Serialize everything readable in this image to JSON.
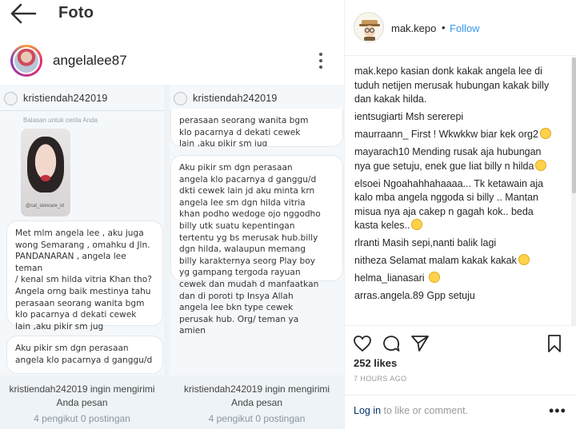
{
  "header": {
    "title": "Foto"
  },
  "post": {
    "username": "angelalee87",
    "screens": [
      {
        "dm_user": "kristiendah242019",
        "reply_label": "Balasan untuk cerita Anda",
        "story_caption": "@cat_skincare_id",
        "bubbles": [
          "Met mlm angela lee , aku juga\nwong Semarang , omahku d Jln.\nPANDANARAN , angela lee teman\n/ kenal sm hilda vitria Khan tho?\nAngela orng baik mestinya tahu\nperasaan seorang wanita bgm\nklo pacarnya d dekati  cewek\nlain ,aku pikir sm jug",
          "Aku pikir sm dgn perasaan\nangela klo pacarnya d ganggu/d"
        ],
        "invite": "kristiendah242019 ingin mengirimi Anda pesan",
        "stats": "4 pengikut 0 postingan"
      },
      {
        "dm_user": "kristiendah242019",
        "bubbles": [
          "perasaan seorang wanita bgm\nklo pacarnya d dekati  cewek\nlain ,aku pikir sm jug",
          "Aku pikir sm dgn perasaan\nangela klo pacarnya d ganggu/d\ndkti cewek lain jd aku minta krn\nangela lee sm dgn hilda vitria\nkhan podho wedoge ojo nggodho\nbilly utk suatu kepentingan\ntertentu yg bs merusak hub.billy\ndgn hilda, walaupun memang\nbilly karakternya seorg Play boy\nyg gampang tergoda rayuan\ncewek dan mudah d manfaatkan\ndan di poroti tp Insya Allah\nangela lee bkn type cewek\nperusak hub. Org/ teman ya\namien"
        ],
        "invite": "kristiendah242019 ingin mengirimi Anda pesan",
        "stats": "4 pengikut 0 postingan"
      }
    ]
  },
  "sidebar": {
    "username": "mak.kepo",
    "dot": "•",
    "follow_label": "Follow",
    "comments": [
      {
        "user": "mak.kepo",
        "text": "kasian donk kakak angela lee di tuduh netijen merusak hubungan kakak billy dan kakak hilda.",
        "emoji": ""
      },
      {
        "user": "ientsugiarti",
        "text": "Msh sererepi",
        "emoji": ""
      },
      {
        "user": "maurraann_",
        "text": "First ! Wkwkkw biar kek org2",
        "emoji": "laughing-emoji"
      },
      {
        "user": "mayarach10",
        "text": "Mending rusak aja hubungan nya gue setuju, enek gue liat billy n hilda",
        "emoji": "laughing-emoji"
      },
      {
        "user": "elsoei",
        "text": "Ngoahahhahaaaa... Tk ketawain aja kalo mba angela nggoda si billy .. Mantan misua nya aja cakep n gagah kok.. beda kasta keles..",
        "emoji": "rolling-eyes-emoji"
      },
      {
        "user": "rlranti",
        "text": "Masih sepi,nanti balik lagi",
        "emoji": ""
      },
      {
        "user": "nitheza",
        "text": "Selamat malam kakak kakak",
        "emoji": "laughing-emoji"
      },
      {
        "user": "helma_lianasari",
        "text": "",
        "emoji": "scream-emoji"
      },
      {
        "user": "arras.angela.89",
        "text": "Gpp setuju",
        "emoji": ""
      }
    ],
    "likes": "252 likes",
    "time": "7 HOURS AGO",
    "login_link": "Log in",
    "login_rest": " to like or comment.",
    "more_label": "•••"
  }
}
